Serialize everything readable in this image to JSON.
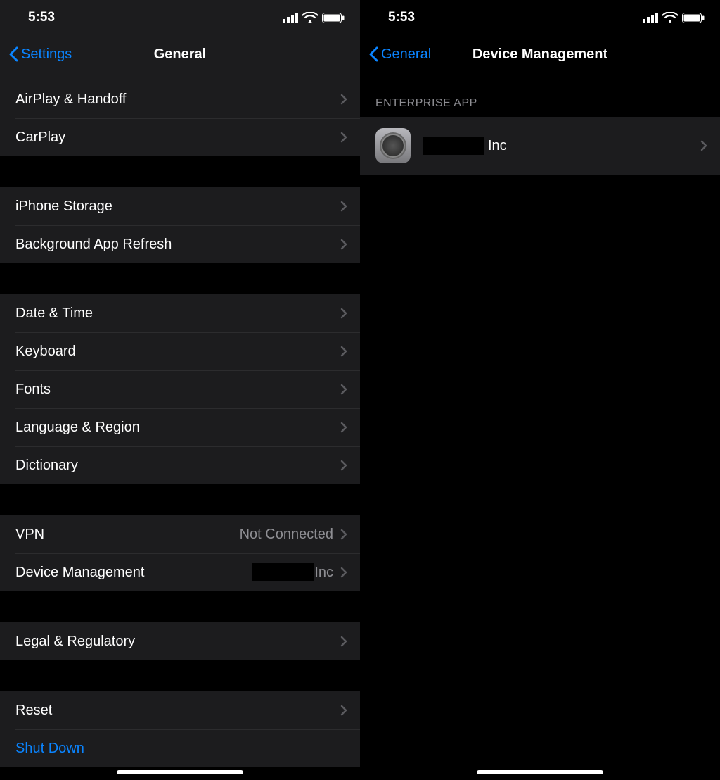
{
  "status": {
    "time": "5:53"
  },
  "left": {
    "back_label": "Settings",
    "title": "General",
    "groups": [
      {
        "items": [
          {
            "label": "AirPlay & Handoff"
          },
          {
            "label": "CarPlay"
          }
        ]
      },
      {
        "items": [
          {
            "label": "iPhone Storage"
          },
          {
            "label": "Background App Refresh"
          }
        ]
      },
      {
        "items": [
          {
            "label": "Date & Time"
          },
          {
            "label": "Keyboard"
          },
          {
            "label": "Fonts"
          },
          {
            "label": "Language & Region"
          },
          {
            "label": "Dictionary"
          }
        ]
      },
      {
        "items": [
          {
            "label": "VPN",
            "value": "Not Connected"
          },
          {
            "label": "Device Management",
            "value_redacted_suffix": "Inc"
          }
        ]
      },
      {
        "items": [
          {
            "label": "Legal & Regulatory"
          }
        ]
      },
      {
        "items": [
          {
            "label": "Reset"
          },
          {
            "label": "Shut Down",
            "blue": true,
            "no_chevron": true
          }
        ]
      }
    ]
  },
  "right": {
    "back_label": "General",
    "title": "Device Management",
    "section_header": "Enterprise App",
    "profile": {
      "name_redacted_suffix": "Inc"
    }
  }
}
